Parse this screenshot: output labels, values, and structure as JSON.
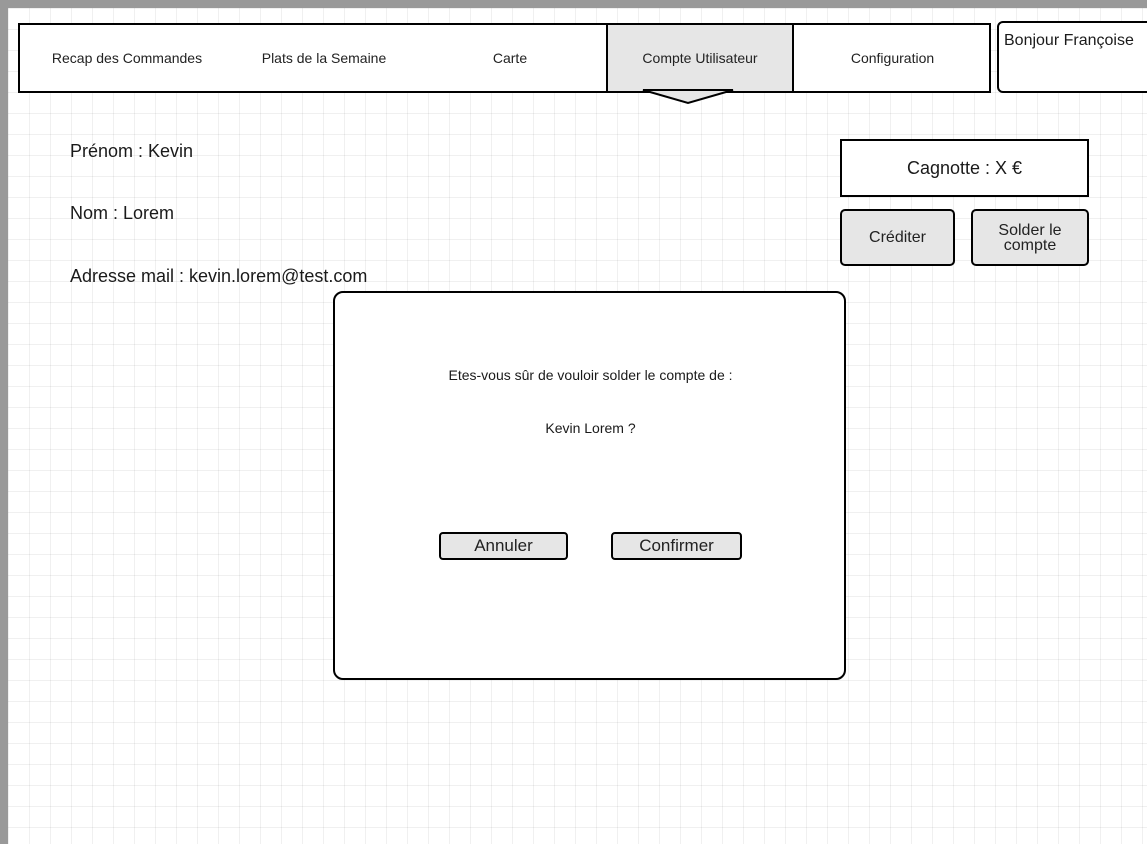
{
  "nav": {
    "tabs": [
      {
        "label": "Recap des Commandes"
      },
      {
        "label": "Plats de la Semaine"
      },
      {
        "label": "Carte"
      },
      {
        "label": "Compte Utilisateur",
        "active": true
      },
      {
        "label": "Configuration"
      }
    ],
    "greeting": "Bonjour Françoise"
  },
  "user": {
    "prenom_line": "Prénom : Kevin",
    "nom_line": "Nom : Lorem",
    "email_line": "Adresse mail : kevin.lorem@test.com"
  },
  "wallet": {
    "cagnotte_label": "Cagnotte : X €",
    "credit_label": "Créditer",
    "settle_label": "Solder le compte"
  },
  "dialog": {
    "question": "Etes-vous sûr de vouloir solder le compte de :",
    "name": "Kevin Lorem ?",
    "cancel_label": "Annuler",
    "confirm_label": "Confirmer"
  },
  "colors": {
    "active_tab": "#e6e6e6",
    "button_fill": "#e6e6e6",
    "border": "#000000",
    "window_frame": "#999999"
  }
}
